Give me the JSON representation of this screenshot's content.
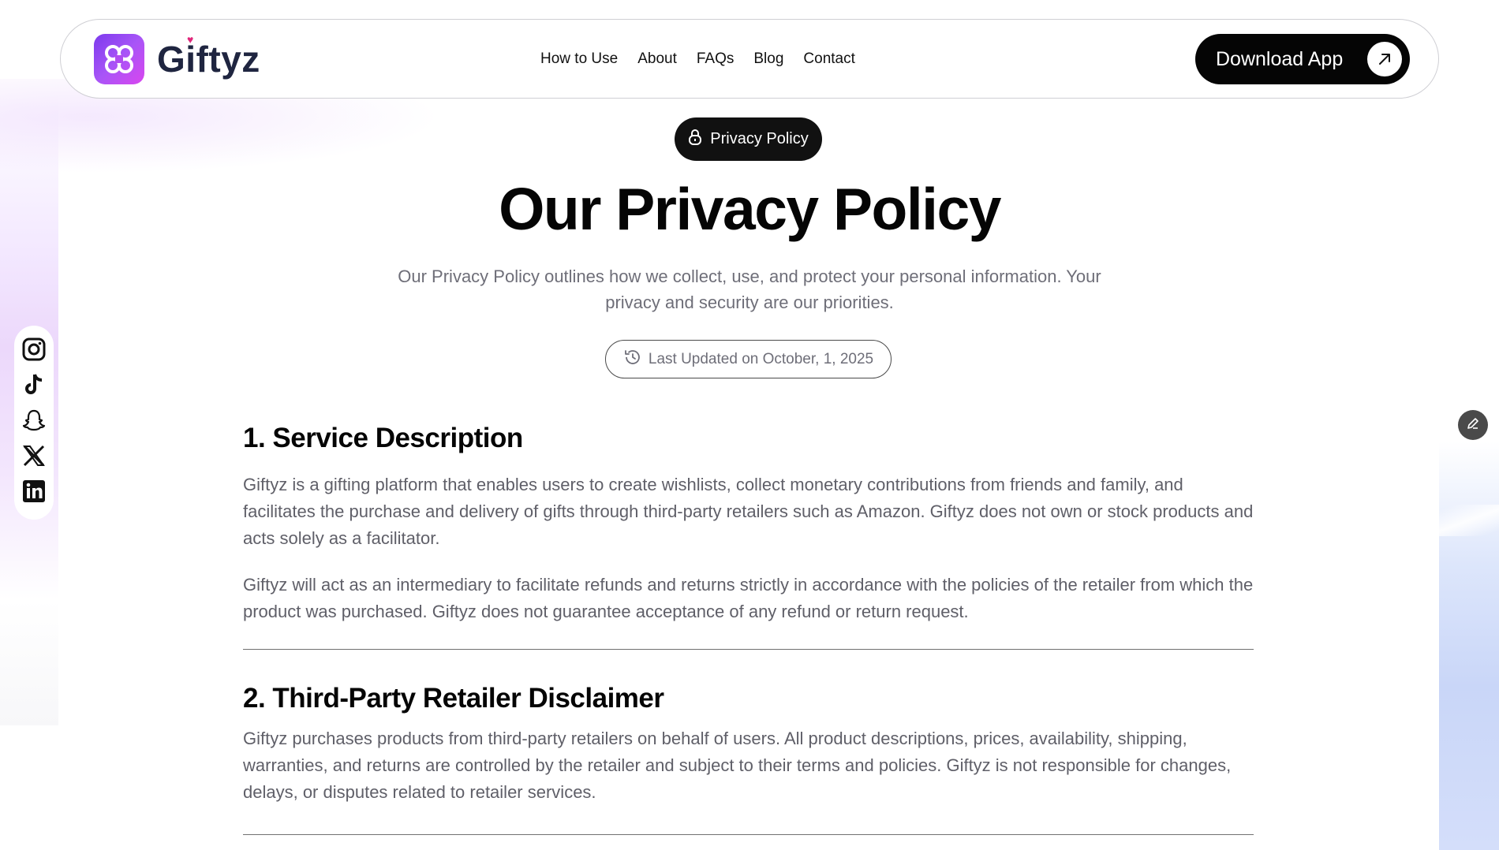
{
  "brand": {
    "name": "Giftyz"
  },
  "nav": {
    "items": [
      "How to Use",
      "About",
      "FAQs",
      "Blog",
      "Contact"
    ],
    "download_label": "Download App"
  },
  "hero": {
    "badge": "Privacy Policy",
    "title": "Our Privacy Policy",
    "subtitle": "Our Privacy Policy outlines how we collect, use, and protect your personal information. Your privacy and security are our priorities.",
    "last_updated": "Last Updated on October, 1, 2025"
  },
  "sections": [
    {
      "title": "1. Service Description",
      "paragraphs": [
        "Giftyz is a gifting platform that enables users to create wishlists, collect monetary contributions from friends and family, and facilitates the purchase and delivery of gifts through third-party retailers such as Amazon. Giftyz does not own or stock products and acts solely as a facilitator.",
        "Giftyz will act as an intermediary to facilitate refunds and returns strictly in accordance with the policies of the retailer from which the product was purchased. Giftyz does not guarantee acceptance of any refund or return request."
      ]
    },
    {
      "title": "2. Third-Party Retailer Disclaimer",
      "paragraphs": [
        "Giftyz purchases products from third-party retailers on behalf of users. All product descriptions, prices, availability, shipping, warranties, and returns are controlled by the retailer and subject to their terms and policies. Giftyz is not responsible for changes, delays, or disputes related to retailer services."
      ]
    }
  ],
  "social": [
    "instagram-icon",
    "tiktok-icon",
    "snapchat-icon",
    "x-icon",
    "linkedin-icon"
  ],
  "colors": {
    "brand_gradient_start": "#7c3aed",
    "brand_gradient_end": "#d946ef",
    "text_dark": "#050505",
    "text_muted": "#5f5f68"
  }
}
